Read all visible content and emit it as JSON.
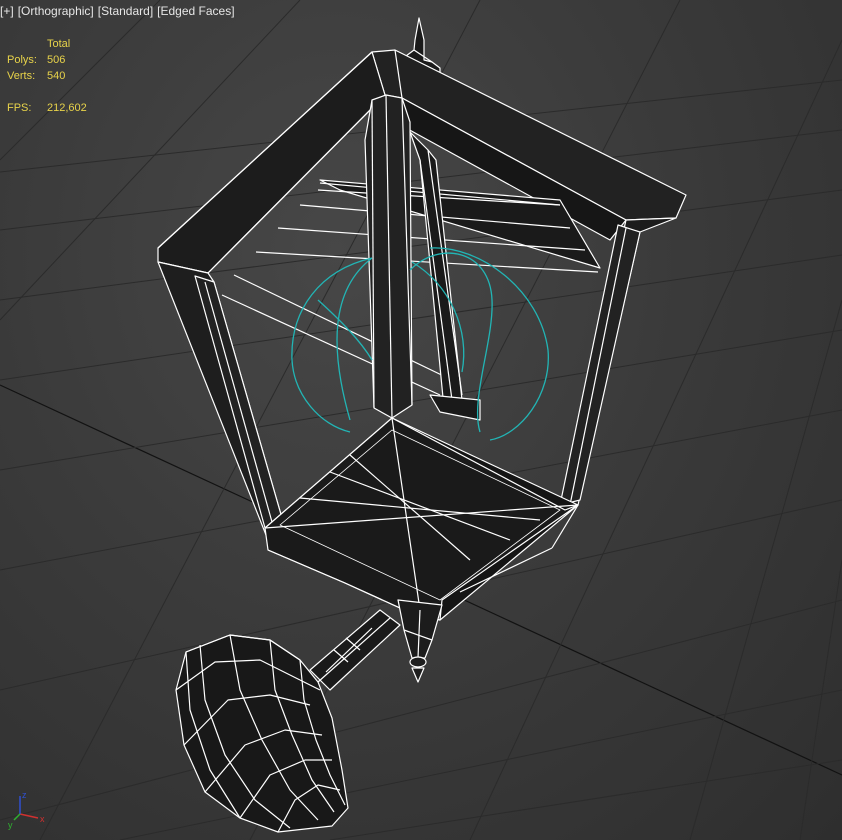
{
  "viewport": {
    "label": {
      "plus": "+",
      "view": "Orthographic",
      "shading": "Standard",
      "mode": "Edged Faces"
    },
    "stats": {
      "header": "Total",
      "polys_label": "Polys:",
      "polys_value": "506",
      "verts_label": "Verts:",
      "verts_value": "540",
      "fps_label": "FPS:",
      "fps_value": "212,602"
    },
    "axis_gizmo": {
      "x": "x",
      "y": "y",
      "z": "z"
    }
  },
  "colors": {
    "background": "#3b3b3b",
    "grid": "#2c2c2c",
    "wire": "#ffffff",
    "mesh": "#141414",
    "light_helper": "#20b3b3",
    "stats_text": "#e8d34a",
    "label_text": "#e6e6e6"
  }
}
